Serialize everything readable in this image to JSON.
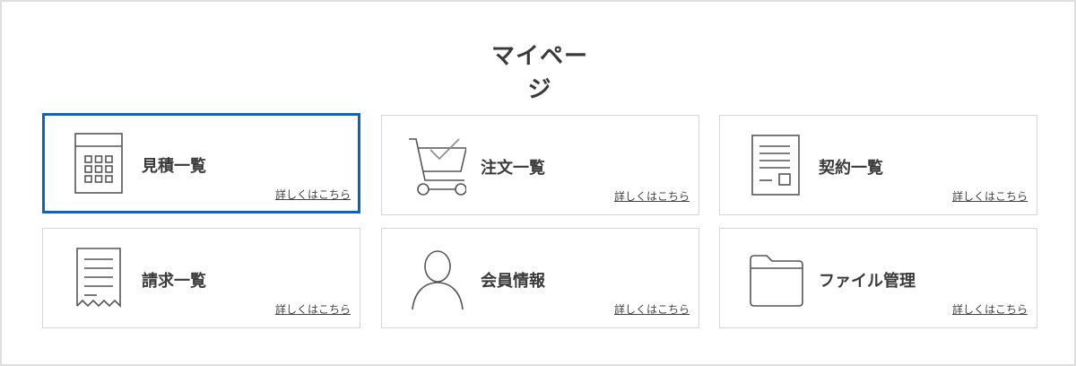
{
  "page_title": "マイページ",
  "accent_color": "#0a63c9",
  "cards": [
    {
      "label": "見積一覧",
      "link": "詳しくはこちら",
      "icon": "calculator-icon",
      "selected": true
    },
    {
      "label": "注文一覧",
      "link": "詳しくはこちら",
      "icon": "cart-check-icon",
      "selected": false
    },
    {
      "label": "契約一覧",
      "link": "詳しくはこちら",
      "icon": "contract-document-icon",
      "selected": false
    },
    {
      "label": "請求一覧",
      "link": "詳しくはこちら",
      "icon": "receipt-icon",
      "selected": false
    },
    {
      "label": "会員情報",
      "link": "詳しくはこちら",
      "icon": "user-icon",
      "selected": false
    },
    {
      "label": "ファイル管理",
      "link": "詳しくはこちら",
      "icon": "folder-icon",
      "selected": false
    }
  ]
}
